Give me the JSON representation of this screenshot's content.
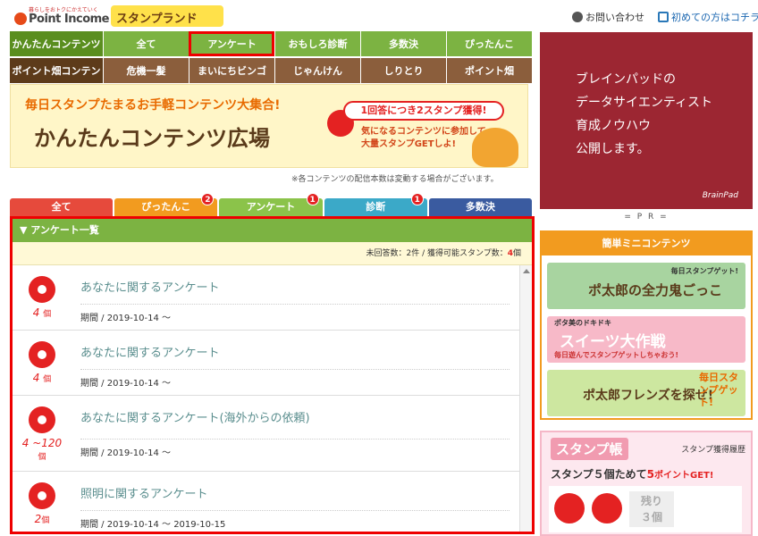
{
  "header": {
    "logo_tagline": "暮らしをおトクにかえていく",
    "logo_name": "Point Income",
    "stamp_land": "スタンプランド",
    "contact": "お問い合わせ",
    "first_time": "初めての方はコチラ"
  },
  "nav": {
    "row1_category": "かんたんコンテンツ",
    "row1": [
      "全て",
      "アンケート",
      "おもしろ診断",
      "多数決",
      "ぴったんこ"
    ],
    "row2_category": "ポイント畑コンテン",
    "row2": [
      "危機一髪",
      "まいにちビンゴ",
      "じゃんけん",
      "しりとり",
      "ポイント畑"
    ]
  },
  "banner": {
    "line1": "毎日スタンプたまるお手軽コンテンツ大集合!",
    "line2": "かんたんコンテンツ広場",
    "pill": "1回答につき2スタンプ獲得!",
    "line3a": "気になるコンテンツに参加して",
    "line3b": "大量スタンプGETしよ!"
  },
  "note": "※各コンテンツの配信本数は変動する場合がございます。",
  "tabs": [
    {
      "label": "全て",
      "badge": ""
    },
    {
      "label": "ぴったんこ",
      "badge": "2"
    },
    {
      "label": "アンケート",
      "badge": "1"
    },
    {
      "label": "診断",
      "badge": "1"
    },
    {
      "label": "多数決",
      "badge": ""
    }
  ],
  "panel": {
    "heading": "▼ アンケート一覧",
    "summary_prefix": "未回答数：2件 / 獲得可能スタンプ数：",
    "summary_count": "4",
    "summary_suffix": "個"
  },
  "surveys": [
    {
      "count": "4",
      "unit": "個",
      "title": "あなたに関するアンケート",
      "period": "期間 / 2019-10-14 ～"
    },
    {
      "count": "4",
      "unit": "個",
      "title": "あなたに関するアンケート",
      "period": "期間 / 2019-10-14 ～"
    },
    {
      "count": "4 ~120",
      "unit": "個",
      "title": "あなたに関するアンケート(海外からの依頼)",
      "period": "期間 / 2019-10-14 ～"
    },
    {
      "count": "2",
      "unit": "個",
      "title": "照明に関するアンケート",
      "period": "期間 / 2019-10-14 ～ 2019-10-15"
    }
  ],
  "ad": {
    "lines": [
      "ブレインパッドの",
      "データサイエンティスト",
      "育成ノウハウ",
      "公開します。"
    ],
    "brand": "BrainPad",
    "pr": "= P R ="
  },
  "mini": {
    "heading": "簡単ミニコンテンツ",
    "banner1_a": "毎日スタンプゲット!",
    "banner1_b": "ポ太郎の全力鬼ごっこ",
    "banner2_a": "ポタ美のドキドキ",
    "banner2_b": "スイーツ大作戦",
    "banner2_c": "毎日遊んでスタンプゲットしちゃおう!",
    "banner3_a": "ポ太郎フレンズを探せ!",
    "banner3_b": "毎日スタンプゲット!"
  },
  "stamp_card": {
    "title": "スタンプ帳",
    "history": "スタンプ獲得履歴",
    "goal_prefix": "スタンプ５個ためて",
    "goal_points": "5",
    "goal_suffix": "ポイントGET!",
    "remain_a": "残り",
    "remain_b": "３個"
  }
}
